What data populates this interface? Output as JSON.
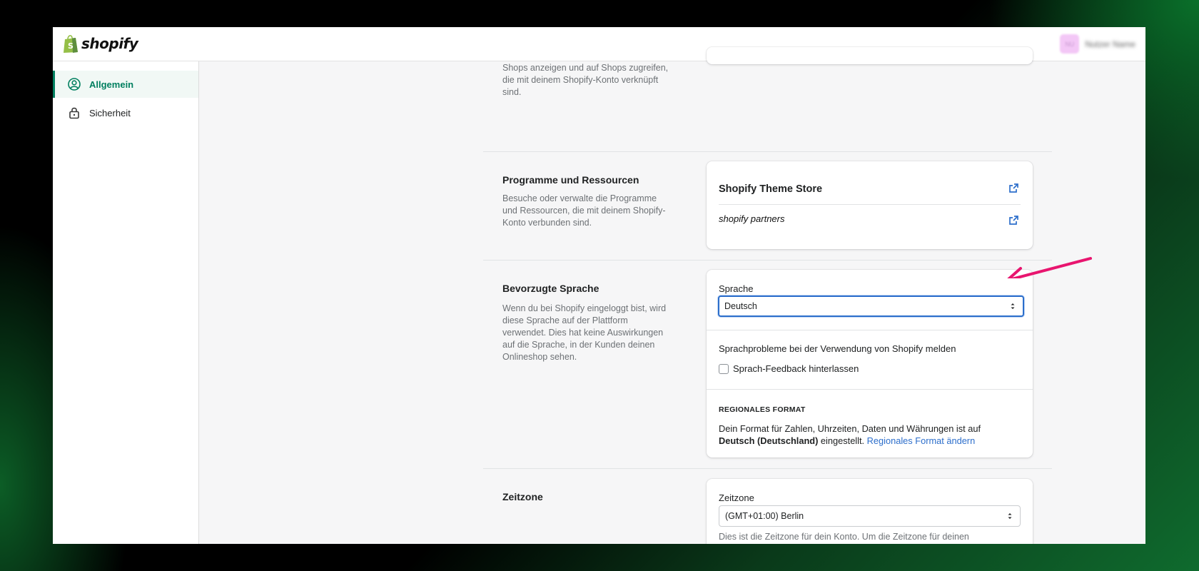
{
  "app": {
    "logo_text": "shopify",
    "user_initials": "NU",
    "user_name": "Nutzer Name"
  },
  "sidebar": {
    "items": [
      {
        "label": "Allgemein",
        "icon": "user-circle-icon",
        "active": true
      },
      {
        "label": "Sicherheit",
        "icon": "lock-icon",
        "active": false
      }
    ]
  },
  "sections": {
    "shops": {
      "description": "Shops anzeigen und auf Shops zugreifen, die mit deinem Shopify-Konto verknüpft sind."
    },
    "programs": {
      "title": "Programme und Ressourcen",
      "description": "Besuche oder verwalte die Programme und Ressourcen, die mit deinem Shopify-Konto verbunden sind.",
      "theme_store": "Shopify Theme Store",
      "partners_logo": "shopify partners"
    },
    "language": {
      "title": "Bevorzugte Sprache",
      "description": "Wenn du bei Shopify eingeloggt bist, wird diese Sprache auf der Plattform verwendet. Dies hat keine Auswirkungen auf die Sprache, in der Kunden deinen Onlineshop sehen.",
      "select_label": "Sprache",
      "select_value": "Deutsch",
      "report_text": "Sprachprobleme bei der Verwendung von Shopify melden",
      "checkbox_label": "Sprach-Feedback hinterlassen",
      "regional_heading": "REGIONALES FORMAT",
      "regional_text_1": "Dein Format für Zahlen, Uhrzeiten, Daten und Währungen ist auf ",
      "regional_bold": "Deutsch (Deutschland)",
      "regional_text_2": " eingestellt. ",
      "regional_link": "Regionales Format ändern"
    },
    "timezone": {
      "title": "Zeitzone",
      "select_label": "Zeitzone",
      "select_value": "(GMT+01:00) Berlin",
      "help_text": "Dies ist die Zeitzone für dein Konto. Um die Zeitzone für deinen Shopify-Adminbereich festzulegen, gehe zum Abschnitt \"Allgemein\" unter \"Einstellungen\"."
    }
  },
  "colors": {
    "accent_green": "#008060",
    "focus_blue": "#2c6ecb",
    "annotation_arrow": "#e8156f"
  }
}
